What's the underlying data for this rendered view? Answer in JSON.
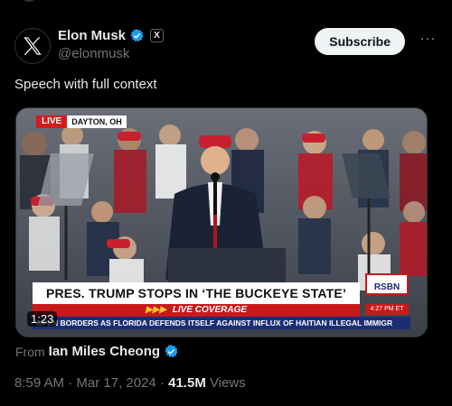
{
  "author": {
    "name": "Elon Musk",
    "handle": "@elonmusk",
    "affiliation_badge": "X",
    "verified_color": "#1d9bf0"
  },
  "header": {
    "subscribe_label": "Subscribe",
    "more_label": "···"
  },
  "tweet": {
    "text": "Speech with full context"
  },
  "media": {
    "live_label": "LIVE",
    "location": "DAYTON, OH",
    "banner_text": "PRES. TRUMP STOPS IN ‘THE BUCKEYE STATE’",
    "coverage_arrows": "▶▶▶",
    "coverage_label": "LIVE COVERAGE",
    "ticker_text": "OPEN BORDERS AS FLORIDA DEFENDS ITSELF AGAINST INFLUX OF HAITIAN ILLEGAL IMMIGR",
    "network_logo": "RSBN",
    "network_time": "4:27 PM ET",
    "duration": "1:23"
  },
  "source": {
    "prefix": "From",
    "name": "Ian Miles Cheong"
  },
  "meta": {
    "time": "8:59 AM",
    "separator": "·",
    "date": "Mar 17, 2024",
    "views_count": "41.5M",
    "views_label": "Views"
  }
}
